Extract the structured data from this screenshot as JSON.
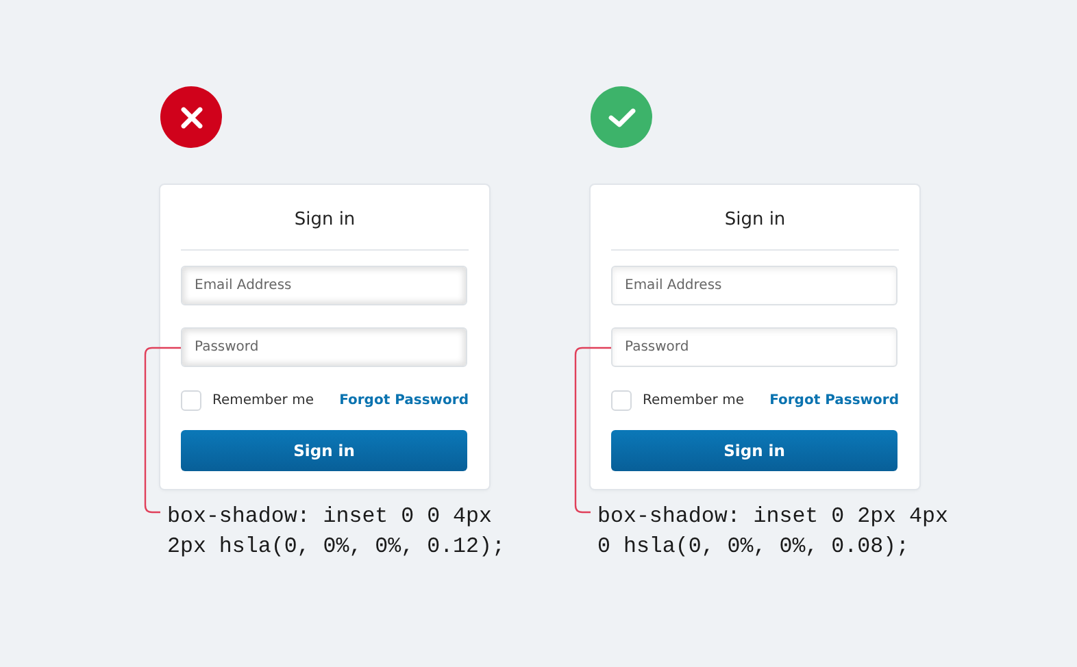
{
  "examples": [
    {
      "kind": "bad",
      "form": {
        "title": "Sign in",
        "email": {
          "placeholder": "Email Address"
        },
        "password": {
          "placeholder": "Password"
        },
        "remember": {
          "label": "Remember me",
          "checked": false
        },
        "forgot_link": "Forgot Password",
        "submit": "Sign in"
      },
      "code": "box-shadow: inset 0 0 4px\n2px hsla(0, 0%, 0%, 0.12);"
    },
    {
      "kind": "good",
      "form": {
        "title": "Sign in",
        "email": {
          "placeholder": "Email Address"
        },
        "password": {
          "placeholder": "Password"
        },
        "remember": {
          "label": "Remember me",
          "checked": false
        },
        "forgot_link": "Forgot Password",
        "submit": "Sign in"
      },
      "code": "box-shadow: inset 0 2px 4px\n0 hsla(0, 0%, 0%, 0.08);"
    }
  ]
}
